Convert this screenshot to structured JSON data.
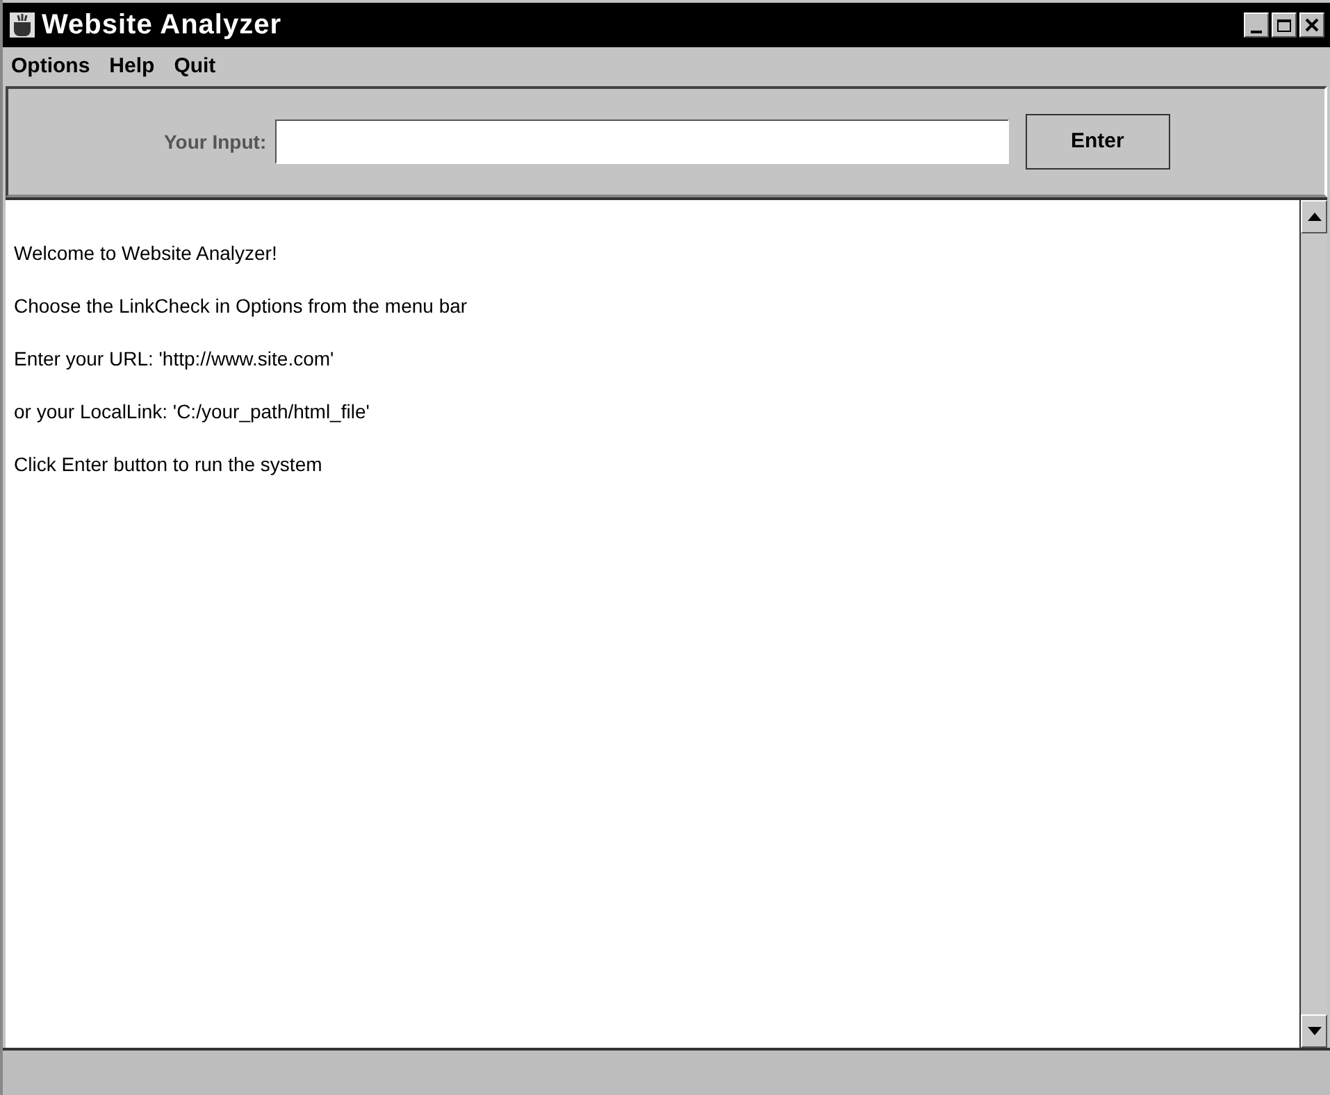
{
  "window": {
    "title": "Website Analyzer"
  },
  "menu": [
    "Options",
    "Help",
    "Quit"
  ],
  "input": {
    "label": "Your Input:"
  },
  "buttons": [
    "Enter"
  ],
  "output_lines": [
    "Welcome to Website Analyzer!",
    "Choose the LinkCheck in Options from the menu bar",
    "Enter your URL: 'http://www.site.com'",
    "or your LocalLink: 'C:/your_path/html_file'",
    "Click Enter button to run the system"
  ]
}
